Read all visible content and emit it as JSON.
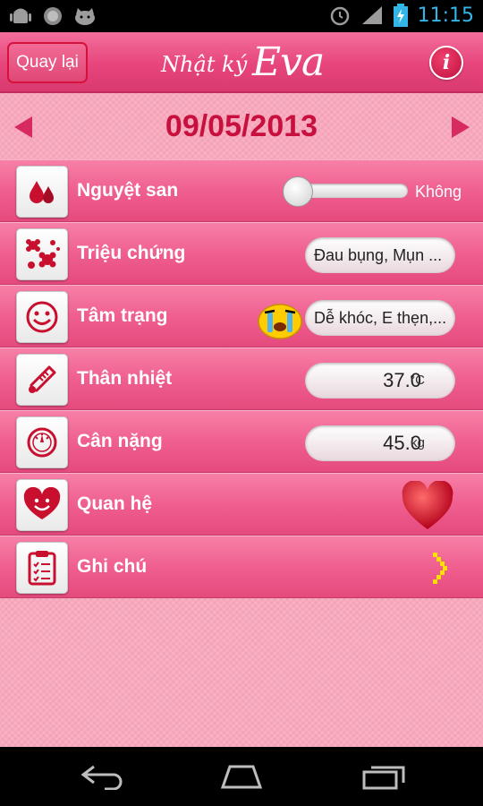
{
  "status_bar": {
    "clock": "11:15"
  },
  "header": {
    "back_label": "Quay lại",
    "title_part1": "Nhật ký",
    "title_part2": "Eva",
    "info_label": "i"
  },
  "date_nav": {
    "date": "09/05/2013"
  },
  "rows": {
    "period": {
      "label": "Nguyệt san",
      "slider_text": "Không",
      "slider_value": 0
    },
    "symptoms": {
      "label": "Triệu chứng",
      "value": "Đau bụng, Mụn ..."
    },
    "mood": {
      "label": "Tâm trạng",
      "value": "Dễ khóc, E thẹn,..."
    },
    "temperature": {
      "label": "Thân nhiệt",
      "value": "37.0",
      "unit": "°C"
    },
    "weight": {
      "label": "Cân nặng",
      "value": "45.0",
      "unit": "kg"
    },
    "relations": {
      "label": "Quan hệ"
    },
    "notes": {
      "label": "Ghi chú"
    }
  },
  "icons": {
    "status_left": [
      "android-icon",
      "circle-icon",
      "cat-icon"
    ],
    "status_right": [
      "alarm-icon",
      "signal-icon",
      "battery-icon"
    ],
    "rows": [
      "blood-drop-icon",
      "flowers-icon",
      "smiley-icon",
      "thermometer-icon",
      "scale-icon",
      "heart-face-icon",
      "clipboard-icon"
    ],
    "nav": [
      "back-icon",
      "home-icon",
      "recent-apps-icon"
    ]
  },
  "colors": {
    "accent": "#e7457b",
    "date": "#c8103f",
    "status_clock": "#33b5e5"
  }
}
